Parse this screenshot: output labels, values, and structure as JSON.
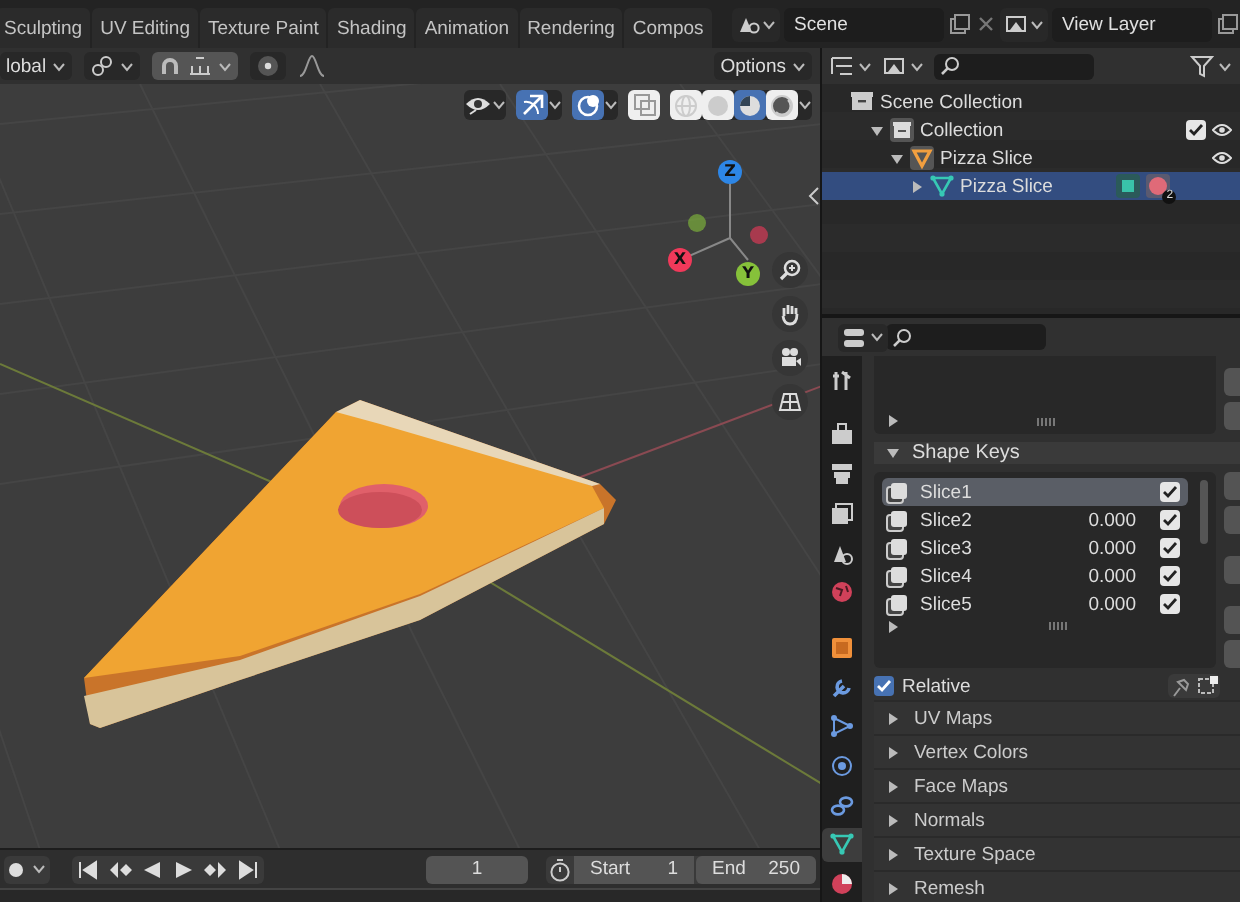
{
  "workspace_tabs": [
    {
      "label": "Sculpting",
      "selected": false
    },
    {
      "label": "UV Editing",
      "selected": false
    },
    {
      "label": "Texture Paint",
      "selected": false
    },
    {
      "label": "Shading",
      "selected": false
    },
    {
      "label": "Animation",
      "selected": false
    },
    {
      "label": "Rendering",
      "selected": false
    },
    {
      "label": "Compos",
      "selected": false
    }
  ],
  "scene_field": {
    "value": "Scene"
  },
  "view_layer_field": {
    "value": "View Layer"
  },
  "viewport_header": {
    "orientation": "lobal",
    "options": "Options"
  },
  "viewport_toggles": [
    {
      "kind": "gizmos",
      "on": true
    },
    {
      "kind": "overlays",
      "on": true
    },
    {
      "kind": "xray",
      "on": false
    }
  ],
  "shading_modes": [
    {
      "kind": "wireframe",
      "selected": false
    },
    {
      "kind": "solid",
      "selected": false
    },
    {
      "kind": "material",
      "selected": true
    },
    {
      "kind": "rendered",
      "selected": false
    }
  ],
  "navigation_gizmo": {
    "axes": [
      {
        "label": "X",
        "color": "#f0395a"
      },
      {
        "label": "Y",
        "color": "#86c13a"
      },
      {
        "label": "Z",
        "color": "#2d86e6"
      }
    ]
  },
  "outliner": {
    "tree": [
      {
        "label": "Scene Collection",
        "kind": "scene_collection",
        "selected": false,
        "children": [
          {
            "label": "Collection",
            "kind": "collection",
            "selected": false,
            "checked": true,
            "children": [
              {
                "label": "Pizza Slice",
                "kind": "object",
                "selected": false,
                "children": [
                  {
                    "label": "Pizza Slice",
                    "kind": "mesh",
                    "selected": true,
                    "badge": "2"
                  }
                ]
              }
            ]
          }
        ]
      }
    ]
  },
  "properties": {
    "tabs": [
      {
        "kind": "tool",
        "selected": false
      },
      {
        "kind": "render",
        "selected": false
      },
      {
        "kind": "output",
        "selected": false
      },
      {
        "kind": "view_layer",
        "selected": false
      },
      {
        "kind": "scene",
        "selected": false
      },
      {
        "kind": "world",
        "selected": false
      },
      {
        "kind": "object",
        "selected": false
      },
      {
        "kind": "modifier",
        "selected": false
      },
      {
        "kind": "particles",
        "selected": false
      },
      {
        "kind": "physics",
        "selected": false
      },
      {
        "kind": "constraints",
        "selected": false
      },
      {
        "kind": "data",
        "selected": true
      },
      {
        "kind": "material",
        "selected": false
      }
    ],
    "shape_keys": {
      "title": "Shape Keys",
      "expanded": true,
      "keys": [
        {
          "name": "Slice1",
          "checked": true,
          "selected": true
        },
        {
          "name": "Slice2",
          "value": "0.000",
          "checked": true,
          "selected": false
        },
        {
          "name": "Slice3",
          "value": "0.000",
          "checked": true,
          "selected": false
        },
        {
          "name": "Slice4",
          "value": "0.000",
          "checked": true,
          "selected": false
        },
        {
          "name": "Slice5",
          "value": "0.000",
          "checked": true,
          "selected": false
        }
      ],
      "relative": {
        "label": "Relative",
        "checked": true
      }
    },
    "panels": [
      {
        "title": "UV Maps",
        "expanded": false
      },
      {
        "title": "Vertex Colors",
        "expanded": false
      },
      {
        "title": "Face Maps",
        "expanded": false
      },
      {
        "title": "Normals",
        "expanded": false
      },
      {
        "title": "Texture Space",
        "expanded": false
      },
      {
        "title": "Remesh",
        "expanded": false
      }
    ]
  },
  "timeline": {
    "current_frame": "1",
    "start_label": "Start",
    "start": "1",
    "end_label": "End",
    "end": "250"
  }
}
